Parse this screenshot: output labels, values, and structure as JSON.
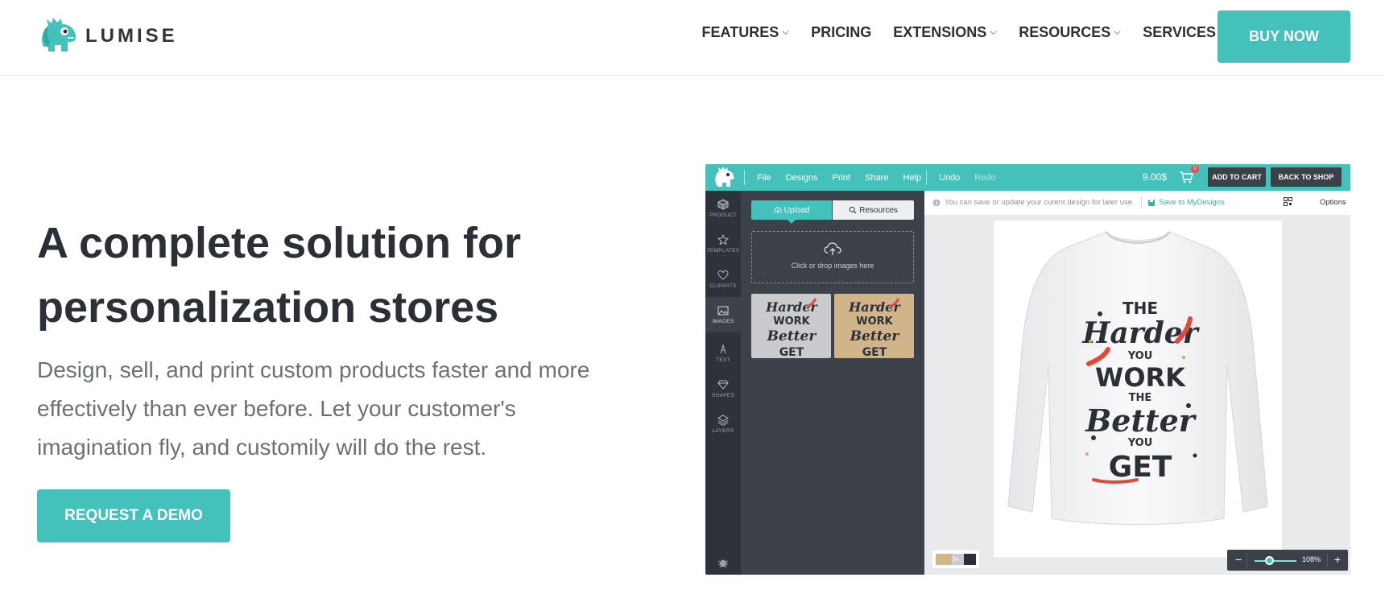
{
  "header": {
    "logo_text": "LUMISE",
    "nav": [
      {
        "label": "FEATURES",
        "has_dropdown": true
      },
      {
        "label": "PRICING",
        "has_dropdown": false
      },
      {
        "label": "EXTENSIONS",
        "has_dropdown": true
      },
      {
        "label": "RESOURCES",
        "has_dropdown": true
      },
      {
        "label": "SERVICES",
        "has_dropdown": false
      }
    ],
    "buy_label": "BUY NOW"
  },
  "hero": {
    "title_line1": "A complete solution for",
    "title_line2": "personalization stores",
    "subtitle_line1": "Design, sell, and print custom products faster and more",
    "subtitle_line2": "effectively than ever before. Let your customer's",
    "subtitle_line3": "imagination fly, and customily will do the rest.",
    "cta_label": "REQUEST A DEMO"
  },
  "editor": {
    "menu": [
      "File",
      "Designs",
      "Print",
      "Share",
      "Help"
    ],
    "undo_label": "Undo",
    "redo_label": "Redo",
    "price": "9.00$",
    "cart_count": "0",
    "add_to_cart_label": "ADD TO CART",
    "back_to_shop_label": "BACK TO SHOP",
    "sidebar": [
      "PRODUCT",
      "TEMPLATES",
      "CLIPARTS",
      "IMAGES",
      "TEXT",
      "SHAPES",
      "LAYERS"
    ],
    "active_sidebar": "IMAGES",
    "upload_tab": "Upload",
    "resources_tab": "Resources",
    "dropzone_text": "Click or drop images here",
    "info_text": "You can save or update your curent design for later use",
    "save_label": "Save to MyDesigns",
    "options_label": "Options",
    "color_count": "3+",
    "zoom_minus": "−",
    "zoom_plus": "+",
    "zoom_value": "108%",
    "zoom_level": 108,
    "design_text": {
      "the1": "THE",
      "harder": "Harder",
      "you1": "YOU",
      "work": "WORK",
      "the2": "THE",
      "better": "Better",
      "you2": "YOU",
      "get": "GET"
    },
    "colors": {
      "accent": "#45c1bc",
      "dark": "#2e333a",
      "panel": "#3d424a"
    }
  }
}
